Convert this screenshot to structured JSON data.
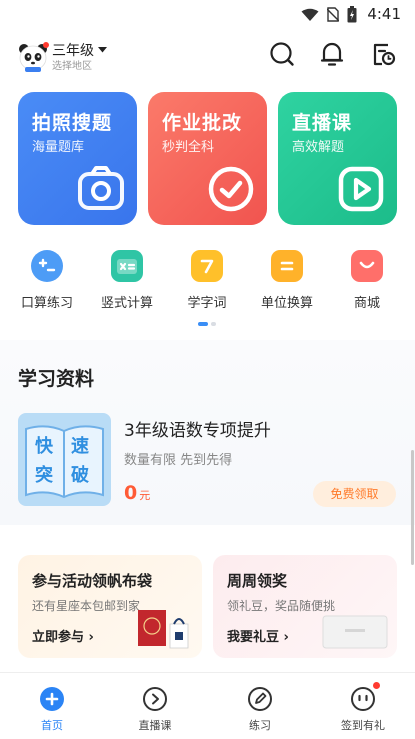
{
  "status_bar": {
    "time": "4:41"
  },
  "header": {
    "grade": "三年级",
    "region": "选择地区"
  },
  "feature_cards": [
    {
      "title": "拍照搜题",
      "subtitle": "海量题库"
    },
    {
      "title": "作业批改",
      "subtitle": "秒判全科"
    },
    {
      "title": "直播课",
      "subtitle": "高效解题"
    }
  ],
  "quick_items": [
    {
      "label": "口算练习"
    },
    {
      "label": "竖式计算"
    },
    {
      "label": "学字词"
    },
    {
      "label": "单位换算"
    },
    {
      "label": "商城"
    }
  ],
  "study_section": {
    "title": "学习资料",
    "book_chars": [
      "快",
      "速",
      "突",
      "破"
    ],
    "product_title": "3年级语数专项提升",
    "product_desc": "数量有限 先到先得",
    "price": "0",
    "price_unit": "元",
    "claim_label": "免费领取"
  },
  "activities": [
    {
      "title": "参与活动领帆布袋",
      "subtitle": "还有星座本包邮到家",
      "link": "立即参与 ›"
    },
    {
      "title": "周周领奖",
      "subtitle": "领礼豆，奖品随便挑",
      "link": "我要礼豆 ›"
    }
  ],
  "tabs": [
    {
      "label": "首页"
    },
    {
      "label": "直播课"
    },
    {
      "label": "练习"
    },
    {
      "label": "签到有礼"
    }
  ],
  "colors": {
    "card_search": "#3b7ff0",
    "card_homework": "#f4625a",
    "card_live": "#22c795",
    "accent_blue": "#2b84f5",
    "price_red": "#ff5b36"
  }
}
